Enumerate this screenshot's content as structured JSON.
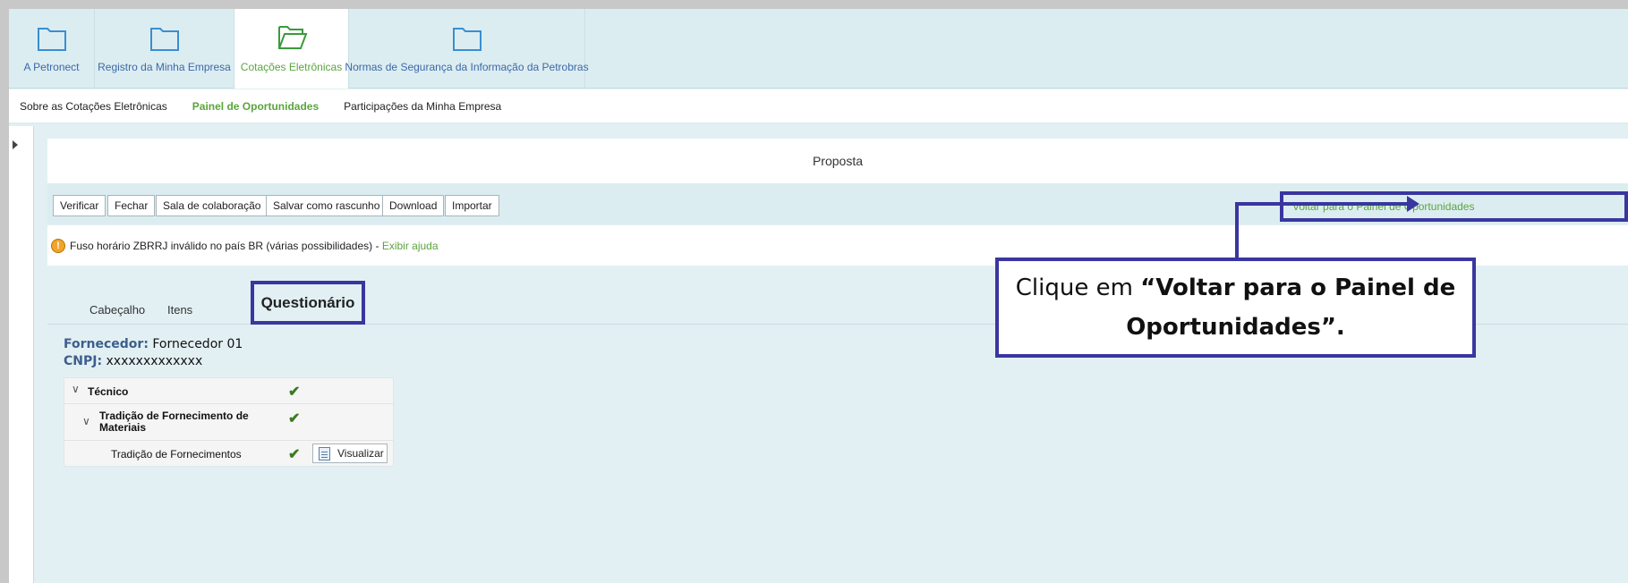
{
  "top_nav": {
    "tabs": [
      {
        "label": "A Petronect",
        "icon": "folder-icon"
      },
      {
        "label": "Registro da Minha Empresa",
        "icon": "folder-icon"
      },
      {
        "label": "Cotações Eletrônicas",
        "icon": "folder-open-icon",
        "active": true
      },
      {
        "label": "Normas de Segurança da Informação da Petrobras",
        "icon": "folder-icon"
      }
    ]
  },
  "sub_nav": {
    "items": [
      {
        "label": "Sobre as Cotações Eletrônicas"
      },
      {
        "label": "Painel de Oportunidades",
        "active": true
      },
      {
        "label": "Participações da Minha Empresa"
      }
    ]
  },
  "page": {
    "title": "Proposta",
    "toolbar": {
      "buttons": [
        "Verificar",
        "Fechar",
        "Sala de colaboração",
        "Salvar como rascunho",
        "Download",
        "Importar"
      ],
      "back_link": "Voltar para o Painel de Oportunidades"
    },
    "message": {
      "text": "Fuso horário ZBRRJ inválido no país BR (várias possibilidades) -",
      "help_link": "Exibir ajuda"
    },
    "tabs": [
      "Cabeçalho",
      "Itens",
      "Questionário"
    ],
    "supplier": {
      "fornecedor_label": "Fornecedor:",
      "fornecedor_value": "Fornecedor 01",
      "cnpj_label": "CNPJ:",
      "cnpj_value": "xxxxxxxxxxxxx"
    },
    "questionnaire": {
      "rows": [
        {
          "label": "Técnico"
        },
        {
          "label": "Tradição de Fornecimento de Materiais"
        },
        {
          "label": "Tradição de Fornecimentos",
          "button": "Visualizar"
        }
      ]
    }
  },
  "callout": {
    "prefix": "Clique em ",
    "bold": "“Voltar para o Painel de Oportunidades”."
  },
  "colors": {
    "accent_green": "#5aa53c",
    "link_blue": "#3d68a8",
    "highlight": "#3a36a0"
  }
}
